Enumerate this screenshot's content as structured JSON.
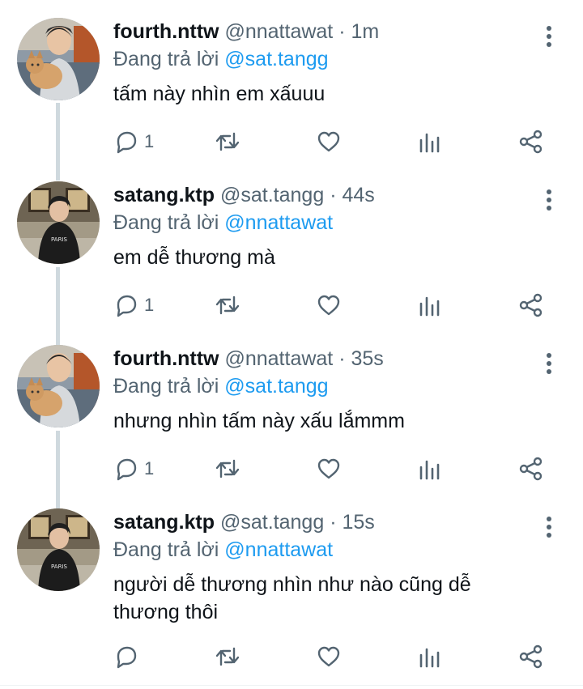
{
  "replying_prefix": "Đang trả lời",
  "colors": {
    "mention": "#1d9bf0",
    "secondary": "#536471",
    "thread_line": "#cfd9de"
  },
  "tweets": [
    {
      "display_name": "fourth.nttw",
      "handle": "@nnattawat",
      "dot": "·",
      "time": "1m",
      "reply_to": "@sat.tangg",
      "text": "tấm này nhìn em xấuuu",
      "reply_count": "1",
      "avatar": "person-with-cat-avatar"
    },
    {
      "display_name": "satang.ktp",
      "handle": "@sat.tangg",
      "dot": "·",
      "time": "44s",
      "reply_to": "@nnattawat",
      "text": "em dễ thương mà",
      "reply_count": "1",
      "avatar": "person-black-tee-avatar"
    },
    {
      "display_name": "fourth.nttw",
      "handle": "@nnattawat",
      "dot": "·",
      "time": "35s",
      "reply_to": "@sat.tangg",
      "text": "nhưng nhìn tấm này xấu lắmmm",
      "reply_count": "1",
      "avatar": "person-with-cat-avatar"
    },
    {
      "display_name": "satang.ktp",
      "handle": "@sat.tangg",
      "dot": "·",
      "time": "15s",
      "reply_to": "@nnattawat",
      "text": "người dễ thương nhìn như nào cũng dễ thương thôi",
      "reply_count": "",
      "avatar": "person-black-tee-avatar"
    }
  ]
}
